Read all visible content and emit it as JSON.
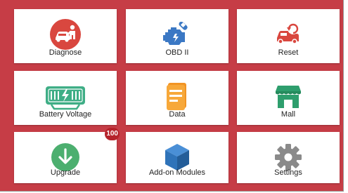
{
  "menu": {
    "tiles": [
      {
        "label": "Diagnose",
        "icon": "car-mechanic-icon",
        "color": "#d9473f"
      },
      {
        "label": "OBD II",
        "icon": "engine-wrench-icon",
        "color": "#3b78c4"
      },
      {
        "label": "Reset",
        "icon": "car-reset-icon",
        "color": "#d9473f"
      },
      {
        "label": "Battery Voltage",
        "icon": "battery-bolt-icon",
        "color": "#3fae86"
      },
      {
        "label": "Data",
        "icon": "document-stack-icon",
        "color": "#f29424"
      },
      {
        "label": "Mall",
        "icon": "store-icon",
        "color": "#2e9e6d"
      },
      {
        "label": "Upgrade",
        "icon": "download-arrow-icon",
        "color": "#4caf6f",
        "badge": "100"
      },
      {
        "label": "Add-on Modules",
        "icon": "cube-icon",
        "color": "#2f73b9"
      },
      {
        "label": "Settings",
        "icon": "gear-icon",
        "color": "#8a8a8a"
      }
    ]
  },
  "colors": {
    "background": "#c63d46",
    "tile": "#ffffff",
    "badge": "#b5232b"
  }
}
